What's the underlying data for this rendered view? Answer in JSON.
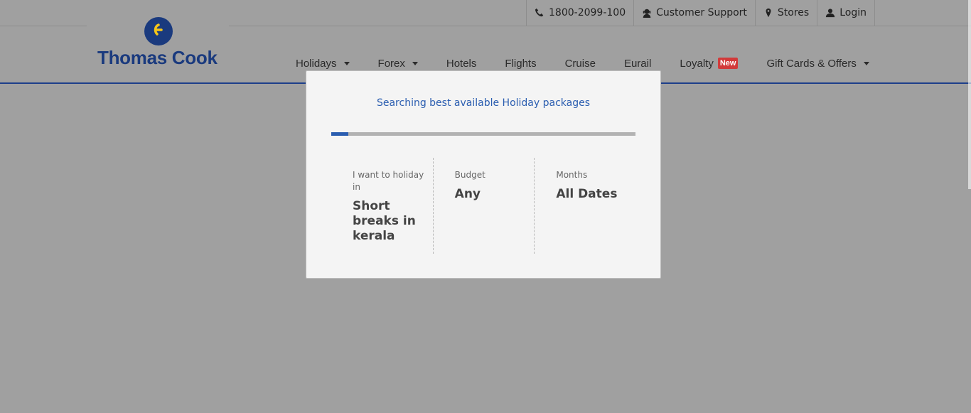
{
  "header": {
    "top_links": [
      {
        "label": "1800-2099-100",
        "icon": "phone-icon"
      },
      {
        "label": "Customer Support",
        "icon": "support-agent-icon"
      },
      {
        "label": "Stores",
        "icon": "map-pin-icon"
      },
      {
        "label": "Login",
        "icon": "user-icon"
      }
    ],
    "logo_text": "Thomas Cook",
    "nav": [
      {
        "label": "Holidays",
        "dropdown": true
      },
      {
        "label": "Forex",
        "dropdown": true
      },
      {
        "label": "Hotels",
        "dropdown": false
      },
      {
        "label": "Flights",
        "dropdown": false
      },
      {
        "label": "Cruise",
        "dropdown": false
      },
      {
        "label": "Eurail",
        "dropdown": false
      },
      {
        "label": "Loyalty",
        "dropdown": false,
        "badge": "New"
      },
      {
        "label": "Gift Cards & Offers",
        "dropdown": true
      }
    ]
  },
  "modal": {
    "title": "Searching best available Holiday packages",
    "progress_fraction": 0.056,
    "fields": [
      {
        "label": "I want to holiday in",
        "value": "Short breaks in kerala"
      },
      {
        "label": "Budget",
        "value": "Any"
      },
      {
        "label": "Months",
        "value": "All Dates"
      }
    ]
  },
  "colors": {
    "brand_blue": "#1a3a7e",
    "accent_blue": "#2a5db0",
    "badge_red": "#d23a3a",
    "overlay_gray": "#a0a0a0"
  }
}
